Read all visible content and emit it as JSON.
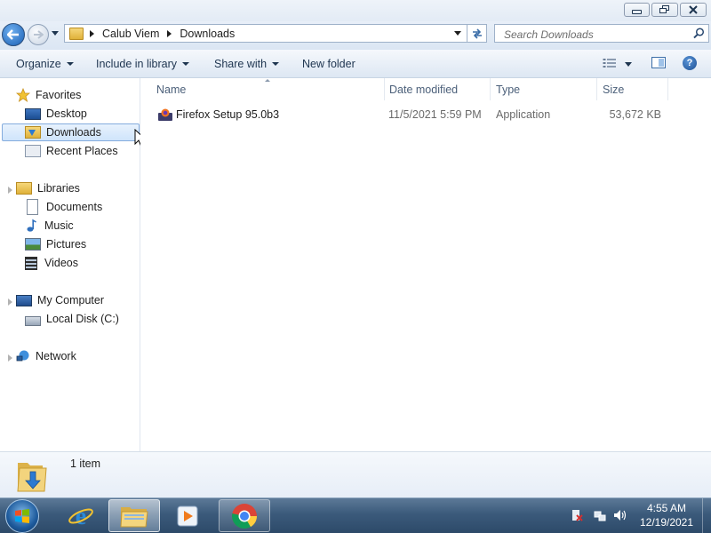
{
  "window": {
    "buttons": [
      "minimize",
      "restore",
      "close"
    ]
  },
  "address": {
    "breadcrumb": [
      "Calub Viem",
      "Downloads"
    ],
    "search_placeholder": "Search Downloads"
  },
  "commandbar": {
    "organize": "Organize",
    "include_in_library": "Include in library",
    "share_with": "Share with",
    "new_folder": "New folder"
  },
  "nav": {
    "favorites": {
      "label": "Favorites",
      "items": [
        {
          "label": "Desktop",
          "icon": "desktop-icon"
        },
        {
          "label": "Downloads",
          "icon": "downloads-folder-icon",
          "selected": true
        },
        {
          "label": "Recent Places",
          "icon": "recent-places-icon"
        }
      ]
    },
    "libraries": {
      "label": "Libraries",
      "items": [
        {
          "label": "Documents",
          "icon": "documents-icon"
        },
        {
          "label": "Music",
          "icon": "music-icon"
        },
        {
          "label": "Pictures",
          "icon": "pictures-icon"
        },
        {
          "label": "Videos",
          "icon": "videos-icon"
        }
      ]
    },
    "computer": {
      "label": "My Computer",
      "items": [
        {
          "label": "Local Disk (C:)",
          "icon": "local-disk-icon"
        }
      ]
    },
    "network": {
      "label": "Network"
    }
  },
  "files": {
    "columns": [
      "Name",
      "Date modified",
      "Type",
      "Size"
    ],
    "rows": [
      {
        "name": "Firefox Setup 95.0b3",
        "date": "11/5/2021 5:59 PM",
        "type": "Application",
        "size": "53,672 KB",
        "icon": "firefox-installer-icon"
      }
    ]
  },
  "details": {
    "count": "1 item"
  },
  "taskbar": {
    "apps": [
      "start-orb",
      "internet-explorer",
      "windows-explorer",
      "media-player",
      "chrome"
    ],
    "active_app": "windows-explorer",
    "clock": {
      "time": "4:55 AM",
      "date": "12/19/2021"
    }
  },
  "colors": {
    "selection": "#cfe4fb",
    "selection_border": "#84acdd",
    "taskbar": "#3b5a7b",
    "column_header_text": "#4c607a"
  }
}
